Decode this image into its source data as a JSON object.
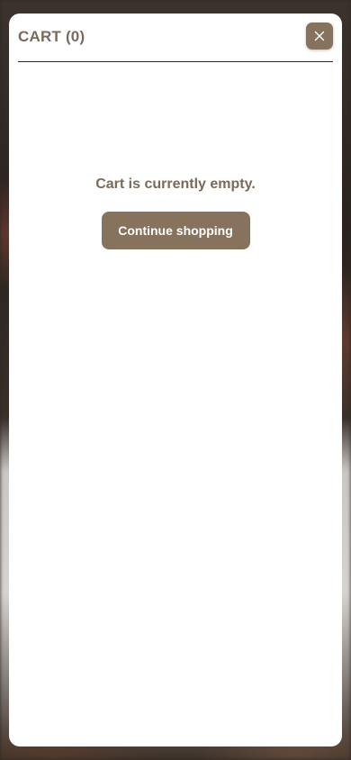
{
  "cart": {
    "title": "CART (0)",
    "empty_message": "Cart is currently empty.",
    "continue_label": "Continue shopping"
  },
  "icons": {
    "close": "close-icon"
  },
  "colors": {
    "accent": "#86725d",
    "title_text": "#7a6a59",
    "drawer_bg": "#ffffff"
  }
}
